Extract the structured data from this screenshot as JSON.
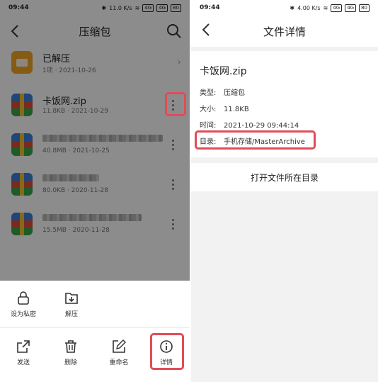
{
  "left": {
    "status": {
      "time": "09:44",
      "icons_text": "11.0 K/s",
      "signal1": "4G",
      "signal2": "4G",
      "battery": "80"
    },
    "title": "压缩包",
    "files": [
      {
        "name": "已解压",
        "meta": "1项 · 2021-10-26",
        "type": "folder"
      },
      {
        "name": "卡饭网.zip",
        "meta": "11.8KB · 2021-10-29",
        "type": "zip"
      },
      {
        "name": "",
        "meta": "40.8MB · 2021-10-25",
        "type": "zip"
      },
      {
        "name": "",
        "meta": "80.0KB · 2020-11-28",
        "type": "zip"
      },
      {
        "name": "",
        "meta": "15.5MB · 2020-11-28",
        "type": "zip"
      }
    ],
    "sheet": {
      "top_actions": [
        {
          "label": "设为私密",
          "icon": "lock-icon"
        },
        {
          "label": "解压",
          "icon": "unzip-icon"
        }
      ],
      "bottom_actions": [
        {
          "label": "发送",
          "icon": "share-icon"
        },
        {
          "label": "删除",
          "icon": "trash-icon"
        },
        {
          "label": "重命名",
          "icon": "edit-icon"
        },
        {
          "label": "详情",
          "icon": "info-icon"
        }
      ]
    },
    "highlight_color": "#e14c57"
  },
  "right": {
    "status": {
      "time": "09:44",
      "icons_text": "4.00 K/s",
      "signal1": "4G",
      "signal2": "4G",
      "battery": "80"
    },
    "title": "文件详情",
    "file_name": "卡饭网.zip",
    "details": [
      {
        "key": "类型:",
        "value": "压缩包"
      },
      {
        "key": "大小:",
        "value": "11.8KB"
      },
      {
        "key": "时间:",
        "value": "2021-10-29 09:44:14"
      },
      {
        "key": "目录:",
        "value": "手机存储/MasterArchive"
      }
    ],
    "open_button": "打开文件所在目录"
  }
}
